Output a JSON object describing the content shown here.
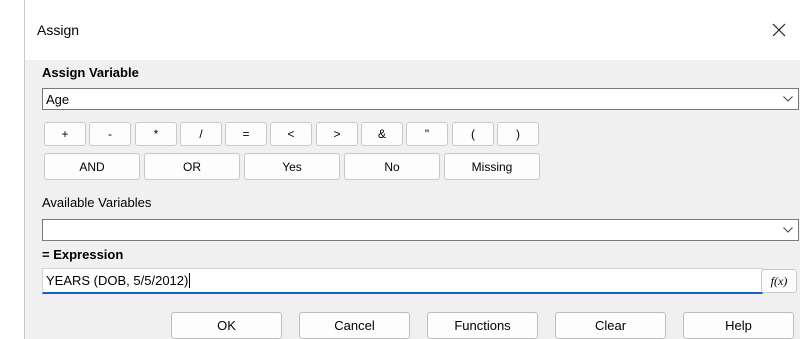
{
  "window": {
    "title": "Assign",
    "close_glyph": "✕"
  },
  "assign_variable": {
    "label": "Assign Variable",
    "value": "Age"
  },
  "operators": [
    "+",
    "-",
    "*",
    "/",
    "=",
    "<",
    ">",
    "&",
    "\"",
    "(",
    ")"
  ],
  "keywords": [
    "AND",
    "OR",
    "Yes",
    "No",
    "Missing"
  ],
  "available_variables": {
    "label": "Available Variables",
    "value": ""
  },
  "expression": {
    "label": "= Expression",
    "value": "YEARS (DOB, 5/5/2012)",
    "function_button": "f(x)"
  },
  "bottom_buttons": [
    "OK",
    "Cancel",
    "Functions",
    "Clear",
    "Help"
  ],
  "colors": {
    "focus_underline": "#1463c7",
    "dialog_bg": "#f0f0f0"
  },
  "icons": {
    "dropdown": "chevron-down-icon",
    "close": "close-icon"
  }
}
